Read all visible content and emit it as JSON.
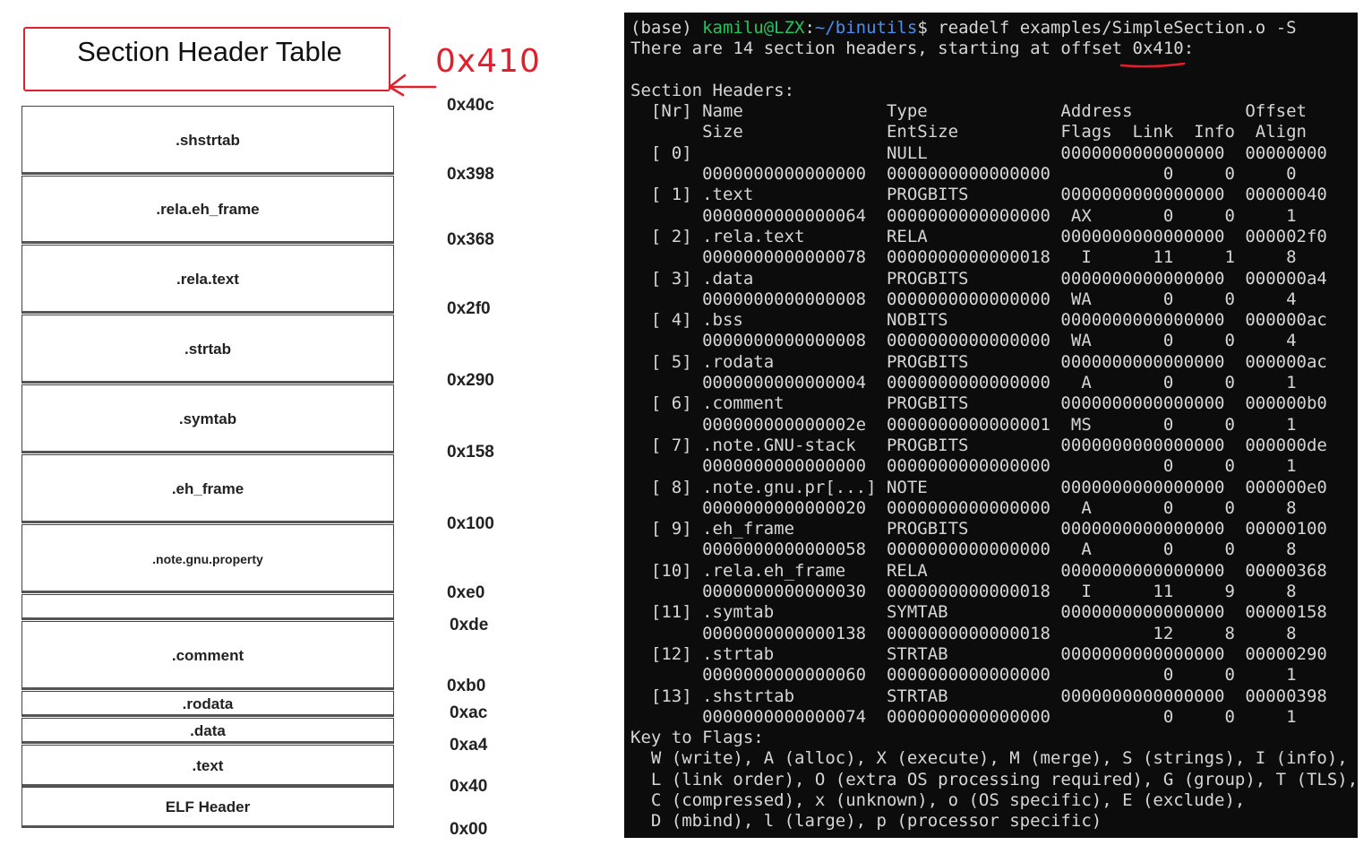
{
  "diagram": {
    "title": "Section Header Table",
    "title_offset_annotation": "0x410",
    "sections": [
      {
        "label": ".shstrtab"
      },
      {
        "label": ".rela.eh_frame"
      },
      {
        "label": ".rela.text"
      },
      {
        "label": ".strtab"
      },
      {
        "label": ".symtab"
      },
      {
        "label": ".eh_frame"
      },
      {
        "label": ".note.gnu.property"
      },
      {
        "label": ""
      },
      {
        "label": ".comment"
      },
      {
        "label": ".rodata"
      },
      {
        "label": ".data"
      },
      {
        "label": ".text"
      },
      {
        "label": "ELF Header"
      }
    ],
    "offsets": [
      "0x40c",
      "0x398",
      "0x368",
      "0x2f0",
      "0x290",
      "0x158",
      "0x100",
      "0xe0",
      "0xde",
      "0xb0",
      "0xac",
      "0xa4",
      "0x40",
      "0x00"
    ],
    "annotation_color": "#e0202c"
  },
  "terminal": {
    "prompt_env": "(base) ",
    "prompt_user": "kamilu@LZX",
    "prompt_sep": ":",
    "prompt_path": "~/binutils",
    "prompt_end": "$ ",
    "command": "readelf examples/SimpleSection.o -S",
    "summary_prefix": "There are 14 section headers, starting at offset ",
    "summary_offset": "0x410",
    "summary_suffix": ":",
    "blank": "",
    "section_headers_title": "Section Headers:",
    "header_line1": "  [Nr] Name              Type             Address           Offset",
    "header_line2": "       Size              EntSize          Flags  Link  Info  Align",
    "rows": [
      {
        "l1": "  [ 0]                   NULL             0000000000000000  00000000",
        "l2": "       0000000000000000  0000000000000000           0     0     0"
      },
      {
        "l1": "  [ 1] .text             PROGBITS         0000000000000000  00000040",
        "l2": "       0000000000000064  0000000000000000  AX       0     0     1"
      },
      {
        "l1": "  [ 2] .rela.text        RELA             0000000000000000  000002f0",
        "l2": "       0000000000000078  0000000000000018   I      11     1     8"
      },
      {
        "l1": "  [ 3] .data             PROGBITS         0000000000000000  000000a4",
        "l2": "       0000000000000008  0000000000000000  WA       0     0     4"
      },
      {
        "l1": "  [ 4] .bss              NOBITS           0000000000000000  000000ac",
        "l2": "       0000000000000008  0000000000000000  WA       0     0     4"
      },
      {
        "l1": "  [ 5] .rodata           PROGBITS         0000000000000000  000000ac",
        "l2": "       0000000000000004  0000000000000000   A       0     0     1"
      },
      {
        "l1": "  [ 6] .comment          PROGBITS         0000000000000000  000000b0",
        "l2": "       000000000000002e  0000000000000001  MS       0     0     1"
      },
      {
        "l1": "  [ 7] .note.GNU-stack   PROGBITS         0000000000000000  000000de",
        "l2": "       0000000000000000  0000000000000000           0     0     1"
      },
      {
        "l1": "  [ 8] .note.gnu.pr[...] NOTE             0000000000000000  000000e0",
        "l2": "       0000000000000020  0000000000000000   A       0     0     8"
      },
      {
        "l1": "  [ 9] .eh_frame         PROGBITS         0000000000000000  00000100",
        "l2": "       0000000000000058  0000000000000000   A       0     0     8"
      },
      {
        "l1": "  [10] .rela.eh_frame    RELA             0000000000000000  00000368",
        "l2": "       0000000000000030  0000000000000018   I      11     9     8"
      },
      {
        "l1": "  [11] .symtab           SYMTAB           0000000000000000  00000158",
        "l2": "       0000000000000138  0000000000000018          12     8     8"
      },
      {
        "l1": "  [12] .strtab           STRTAB           0000000000000000  00000290",
        "l2": "       0000000000000060  0000000000000000           0     0     1"
      },
      {
        "l1": "  [13] .shstrtab         STRTAB           0000000000000000  00000398",
        "l2": "       0000000000000074  0000000000000000           0     0     1"
      }
    ],
    "key_title": "Key to Flags:",
    "key_lines": [
      "  W (write), A (alloc), X (execute), M (merge), S (strings), I (info),",
      "  L (link order), O (extra OS processing required), G (group), T (TLS),",
      "  C (compressed), x (unknown), o (OS specific), E (exclude),",
      "  D (mbind), l (large), p (processor specific)"
    ],
    "prompt_color": "#23c55e",
    "path_color": "#4a8ff5"
  }
}
